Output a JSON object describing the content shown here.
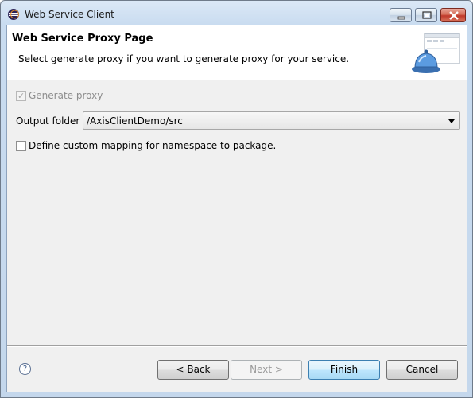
{
  "window": {
    "title": "Web Service Client"
  },
  "banner": {
    "title": "Web Service Proxy Page",
    "description": "Select generate proxy if you want to generate proxy for your service."
  },
  "form": {
    "generate_proxy_label": "Generate proxy",
    "generate_proxy_checked": true,
    "generate_proxy_enabled": false,
    "output_folder_label": "Output folder",
    "output_folder_value": "/AxisClientDemo/src",
    "custom_mapping_label": "Define custom mapping for namespace to package.",
    "custom_mapping_checked": false
  },
  "footer": {
    "help_symbol": "?",
    "back_label": "< Back",
    "next_label": "Next >",
    "finish_label": "Finish",
    "cancel_label": "Cancel"
  },
  "icons": {
    "app": "eclipse-icon",
    "banner": "web-service-wizard-icon",
    "help": "help-icon",
    "dropdown": "chevron-down-icon"
  }
}
